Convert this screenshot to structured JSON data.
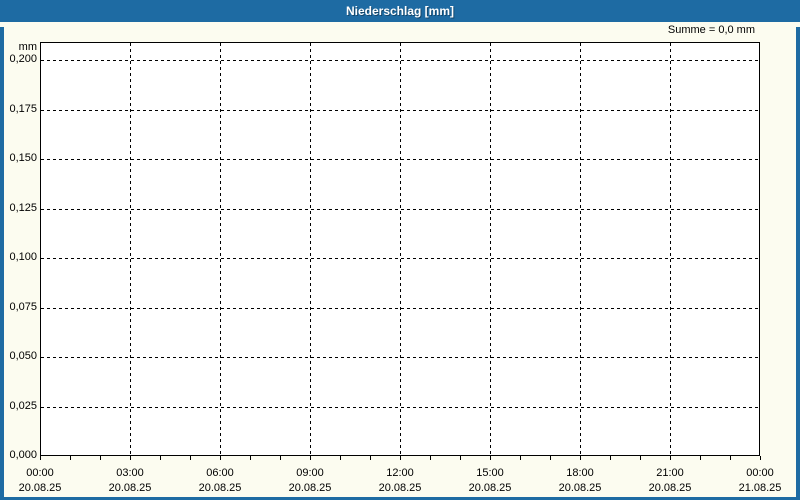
{
  "window": {
    "title": "Niederschlag [mm]"
  },
  "summary": {
    "label": "Summe = 0,0 mm"
  },
  "colors": {
    "title_bar_blue": "#1e6ba3",
    "frame_blue": "#1e6ba3",
    "panel_background": "#fcfcf0",
    "plot_background": "#ffffff",
    "grid_color": "#000000",
    "title_text": "#ffffff",
    "label_text": "#000000"
  },
  "chart_data": {
    "type": "line",
    "title": "Niederschlag [mm]",
    "ylabel": "mm",
    "xlabel": "",
    "annotation": "Summe = 0,0 mm",
    "ylim": [
      0,
      0.209
    ],
    "grid": "dashed",
    "legend": null,
    "y_ticks": [
      {
        "label": "0,200",
        "value": 0.2
      },
      {
        "label": "0,175",
        "value": 0.175
      },
      {
        "label": "0,150",
        "value": 0.15
      },
      {
        "label": "0,125",
        "value": 0.125
      },
      {
        "label": "0,100",
        "value": 0.1
      },
      {
        "label": "0,075",
        "value": 0.075
      },
      {
        "label": "0,050",
        "value": 0.05
      },
      {
        "label": "0,025",
        "value": 0.025
      },
      {
        "label": "0,000",
        "value": 0.0
      }
    ],
    "x_ticks": [
      {
        "time": "00:00",
        "date": "20.08.25"
      },
      {
        "time": "03:00",
        "date": "20.08.25"
      },
      {
        "time": "06:00",
        "date": "20.08.25"
      },
      {
        "time": "09:00",
        "date": "20.08.25"
      },
      {
        "time": "12:00",
        "date": "20.08.25"
      },
      {
        "time": "15:00",
        "date": "20.08.25"
      },
      {
        "time": "18:00",
        "date": "20.08.25"
      },
      {
        "time": "21:00",
        "date": "20.08.25"
      },
      {
        "time": "00:00",
        "date": "21.08.25"
      }
    ],
    "major_x_tick_interval_hours": 3,
    "minor_x_tick_interval_hours": 1,
    "series": [
      {
        "name": "Niederschlag",
        "values": []
      }
    ]
  }
}
